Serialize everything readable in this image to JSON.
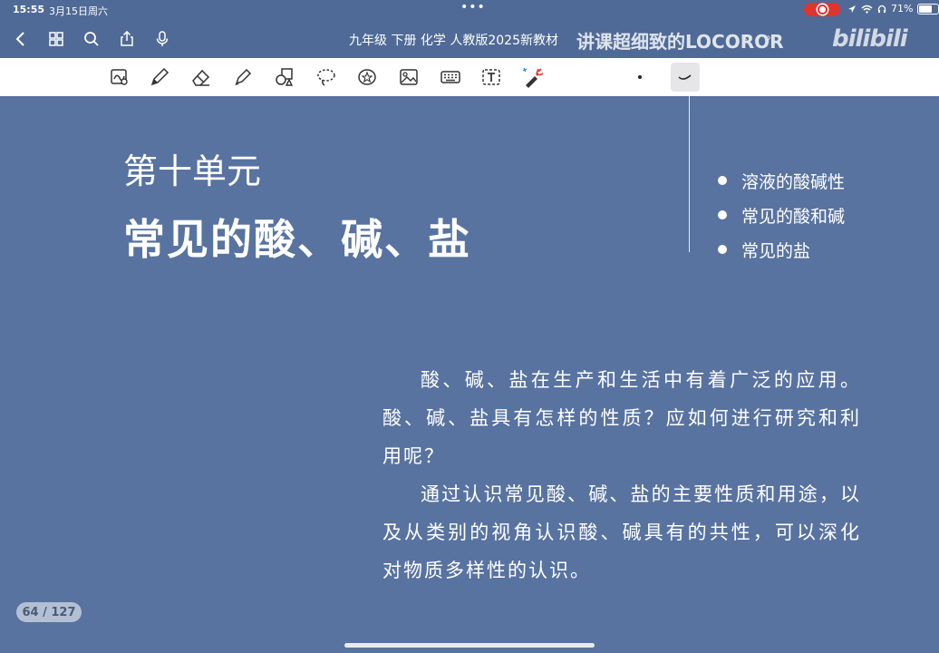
{
  "status_bar": {
    "time": "15:55",
    "date": "3月15日周六",
    "battery": "71%",
    "battery_level": 0.71
  },
  "nav": {
    "document_title": "九年级 下册 化学 人教版2025新教材",
    "watermark_text": "讲课超细致的LOCOROR",
    "bilibili_logo": "bilibili",
    "icons": [
      "back-icon",
      "grid-icon",
      "search-icon",
      "share-icon",
      "microphone-icon"
    ]
  },
  "toolbar": {
    "tools": [
      "lasso-capture",
      "pen",
      "eraser",
      "highlighter",
      "shapes",
      "lasso",
      "sticker",
      "image",
      "keyboard",
      "text-box",
      "laser-pointer",
      "dot",
      "curve-stroke"
    ],
    "selected": "curve-stroke"
  },
  "slide": {
    "unit_title": "第十单元",
    "chapter_title": "常见的酸、碱、盐",
    "toc": [
      {
        "label": "溶液的酸碱性"
      },
      {
        "label": "常见的酸和碱"
      },
      {
        "label": "常见的盐"
      }
    ],
    "paragraphs": [
      "酸、碱、盐在生产和生活中有着广泛的应用。酸、碱、盐具有怎样的性质？应如何进行研究和利用呢？",
      "通过认识常见酸、碱、盐的主要性质和用途，以及从类别的视角认识酸、碱具有的共性，可以深化对物质多样性的认识。"
    ]
  },
  "page_indicator": "64 / 127",
  "colors": {
    "slide_background": "#5873a0",
    "chrome_background": "#4f6a96",
    "recording": "#e0342f"
  }
}
